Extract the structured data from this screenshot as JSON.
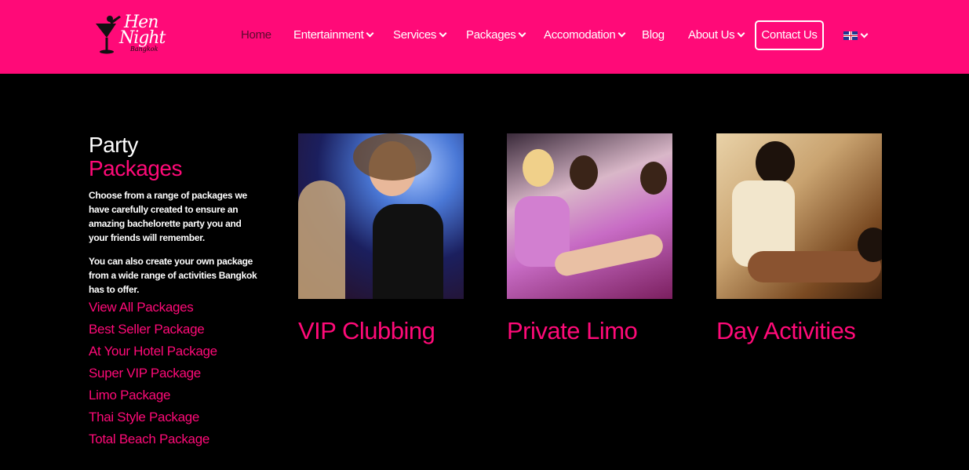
{
  "header": {
    "logo": {
      "line1": "Hen",
      "line2": "Night",
      "line3": "Bangkok"
    },
    "nav": [
      {
        "label": "Home",
        "has_dropdown": false,
        "active": true
      },
      {
        "label": "Entertainment",
        "has_dropdown": true
      },
      {
        "label": "Services",
        "has_dropdown": true
      },
      {
        "label": "Packages",
        "has_dropdown": true
      },
      {
        "label": "Accomodation",
        "has_dropdown": true
      },
      {
        "label": "Blog",
        "has_dropdown": false
      },
      {
        "label": "About Us",
        "has_dropdown": true
      }
    ],
    "contact_label": "Contact Us",
    "language_icon": "uk-flag-icon"
  },
  "sidebar": {
    "title_line1": "Party",
    "title_line2": "Packages",
    "paragraph1": "Choose from a range of packages we have carefully created to ensure an amazing bachelorette party you and your friends will remember.",
    "paragraph2": "You can also create your own package from a wide range of activities Bangkok has to offer.",
    "links": [
      "View All Packages",
      "Best Seller Package",
      "At Your Hotel Package",
      "Super VIP Package",
      "Limo Package",
      "Thai Style Package",
      "Total Beach Package"
    ]
  },
  "cards": [
    {
      "title": "VIP Clubbing"
    },
    {
      "title": "Private Limo"
    },
    {
      "title": "Day Activities"
    }
  ],
  "colors": {
    "brand_pink": "#ff0a78",
    "background": "#000000"
  }
}
